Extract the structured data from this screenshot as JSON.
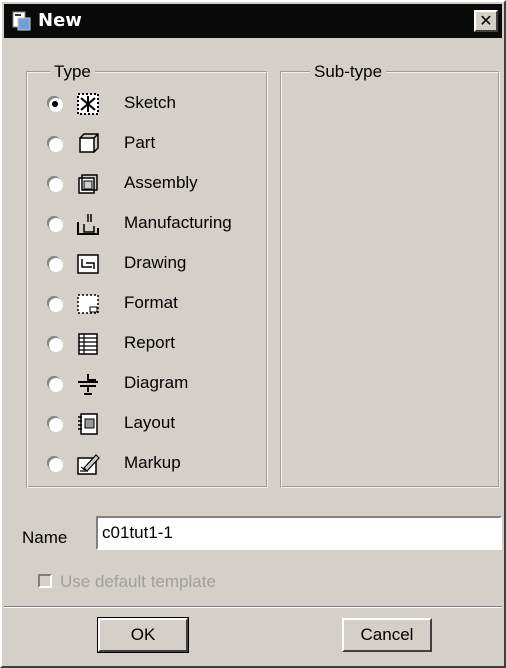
{
  "window": {
    "title": "New",
    "close_glyph": "✕",
    "title_icon": "new-file-icon"
  },
  "type_group": {
    "legend": "Type",
    "options": [
      {
        "label": "Sketch",
        "icon": "sketch-icon",
        "selected": true
      },
      {
        "label": "Part",
        "icon": "part-icon",
        "selected": false
      },
      {
        "label": "Assembly",
        "icon": "assembly-icon",
        "selected": false
      },
      {
        "label": "Manufacturing",
        "icon": "manufacturing-icon",
        "selected": false
      },
      {
        "label": "Drawing",
        "icon": "drawing-icon",
        "selected": false
      },
      {
        "label": "Format",
        "icon": "format-icon",
        "selected": false
      },
      {
        "label": "Report",
        "icon": "report-icon",
        "selected": false
      },
      {
        "label": "Diagram",
        "icon": "diagram-icon",
        "selected": false
      },
      {
        "label": "Layout",
        "icon": "layout-icon",
        "selected": false
      },
      {
        "label": "Markup",
        "icon": "markup-icon",
        "selected": false
      }
    ]
  },
  "subtype_group": {
    "legend": "Sub-type"
  },
  "name_field": {
    "label": "Name",
    "value": "c01tut1-1"
  },
  "default_template": {
    "label": "Use default template",
    "checked": false,
    "enabled": false
  },
  "buttons": {
    "ok": "OK",
    "cancel": "Cancel"
  }
}
